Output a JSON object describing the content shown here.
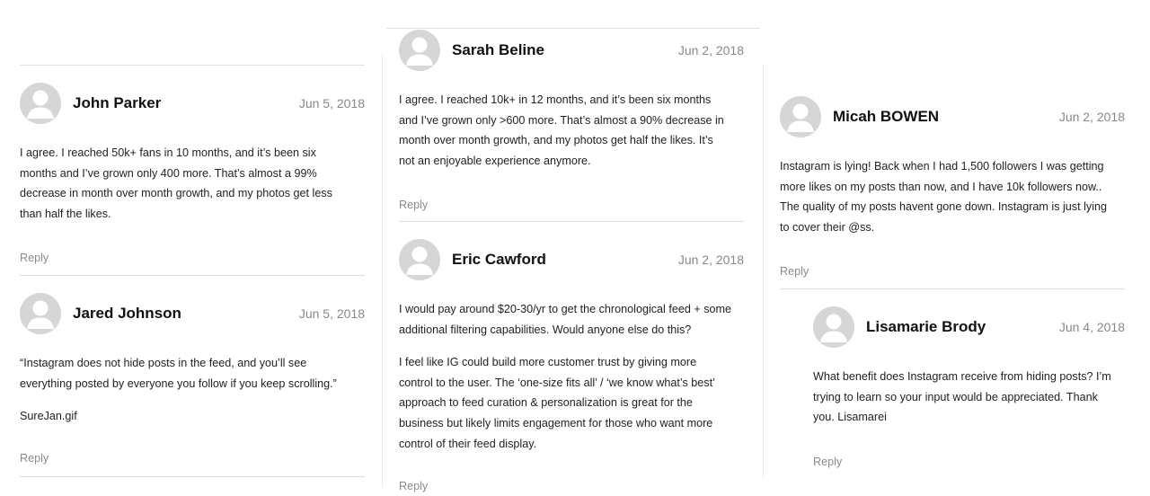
{
  "reply_label": "Reply",
  "avatar_icon": "default-user-avatar-icon",
  "comments": {
    "john": {
      "name": "John Parker",
      "date": "Jun 5, 2018",
      "lines": [
        "I agree. I reached 50k+ fans in 10 months, and it’s been six",
        "months and I’ve grown only 400 more. That’s almost a 99%",
        "decrease in month over month growth, and my photos get less",
        "than half the likes."
      ]
    },
    "jared": {
      "name": "Jared Johnson",
      "date": "Jun 5, 2018",
      "lines": [
        "“Instagram does not hide posts in the feed, and you’ll see",
        "everything posted by everyone you follow if you keep scrolling.”"
      ],
      "lines2": [
        "SureJan.gif"
      ]
    },
    "sarah": {
      "name": "Sarah Beline",
      "date": "Jun 2, 2018",
      "lines": [
        "I agree. I reached 10k+ in 12 months, and it’s been six months",
        "and I’ve grown only >600 more. That’s almost a 90% decrease in",
        "month over month growth, and my photos get half the likes. It’s",
        "not an enjoyable experience anymore."
      ]
    },
    "eric": {
      "name": "Eric Cawford",
      "date": "Jun 2, 2018",
      "lines": [
        "I would pay around $20-30/yr to get the chronological feed + some",
        "additional filtering capabilities. Would anyone else do this?"
      ],
      "lines2": [
        "I feel like IG could build more customer trust by giving more",
        "control to the user. The ‘one-size fits all’ / ‘we know what’s best’",
        "approach to feed curation & personalization is great for the",
        "business but likely limits engagement for those who want more",
        "control of their feed display."
      ]
    },
    "micah": {
      "name": "Micah BOWEN",
      "date": "Jun 2, 2018",
      "lines": [
        "Instagram is lying! Back when I had 1,500 followers I was getting",
        "more likes on my posts than now, and I have 10k followers now..",
        "The quality of my posts havent gone down. Instagram is just lying",
        "to cover their @ss."
      ]
    },
    "lisamarie": {
      "name": "Lisamarie Brody",
      "date": "Jun 4, 2018",
      "lines": [
        "What benefit does Instagram receive from hiding posts? I’m",
        "trying to learn so your input would be appreciated. Thank",
        "you. Lisamarei"
      ]
    }
  }
}
